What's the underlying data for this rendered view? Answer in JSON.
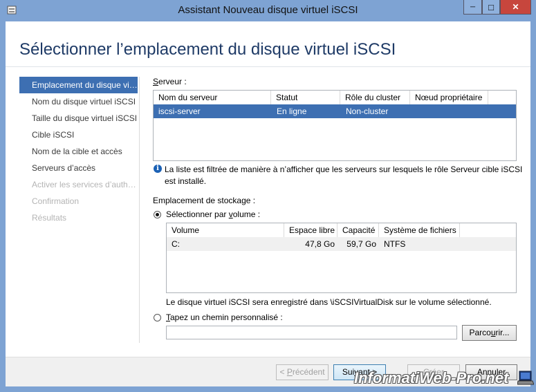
{
  "window": {
    "title": "Assistant Nouveau disque virtuel iSCSI",
    "page_title": "Sélectionner l’emplacement du disque virtuel iSCSI",
    "caption_minimize": "─",
    "caption_maximize": "□",
    "caption_close": "✕"
  },
  "sidebar": {
    "items": [
      {
        "label": "Emplacement du disque virtuel iSCSI",
        "state": "active"
      },
      {
        "label": "Nom du disque virtuel iSCSI",
        "state": "normal"
      },
      {
        "label": "Taille du disque virtuel iSCSI",
        "state": "normal"
      },
      {
        "label": "Cible iSCSI",
        "state": "normal"
      },
      {
        "label": "Nom de la cible et accès",
        "state": "normal"
      },
      {
        "label": "Serveurs d’accès",
        "state": "normal"
      },
      {
        "label": "Activer les services d’authentification",
        "state": "disabled"
      },
      {
        "label": "Confirmation",
        "state": "disabled"
      },
      {
        "label": "Résultats",
        "state": "disabled"
      }
    ]
  },
  "server_section": {
    "label_accel": "S",
    "label_rest": "erveur :",
    "columns": [
      "Nom du serveur",
      "Statut",
      "Rôle du cluster",
      "Nœud propriétaire"
    ],
    "rows": [
      {
        "name": "iscsi-server",
        "status": "En ligne",
        "role": "Non-cluster",
        "owner": ""
      }
    ],
    "info_glyph": "i",
    "info_text_line1": "La liste est filtrée de manière à n’afficher que les serveurs sur lesquels le rôle Serveur cible iSCSI",
    "info_text_line2": "est installé."
  },
  "storage_section": {
    "label": "Emplacement de stockage :",
    "by_volume_pre": "Sélectionner par ",
    "by_volume_accel": "v",
    "by_volume_post": "olume :",
    "volume_columns": [
      "Volume",
      "Espace libre",
      "Capacité",
      "Système de fichiers"
    ],
    "volumes": [
      {
        "volume": "C:",
        "free": "47,8 Go",
        "capacity": "59,7 Go",
        "fs": "NTFS"
      }
    ],
    "save_note": "Le disque virtuel iSCSI sera enregistré dans \\iSCSIVirtualDisk sur le volume sélectionné.",
    "custom_path_accel": "T",
    "custom_path_rest": "apez un chemin personnalisé :",
    "custom_path_value": "",
    "browse_pre": "Parco",
    "browse_accel": "u",
    "browse_post": "rir..."
  },
  "footer": {
    "previous_pre": "< ",
    "previous_accel": "P",
    "previous_post": "récédent",
    "next_pre": "Sui",
    "next_accel": "v",
    "next_post": "ant >",
    "create_pre": "",
    "create_accel": "C",
    "create_post": "réer",
    "cancel": "Annuler"
  },
  "watermark": "InformatiWeb-Pro.net",
  "colors": {
    "frame": "#7ea3d3",
    "selection": "#3d6fb2",
    "title_blue": "#1e3a66",
    "close_button": "#c7463d"
  }
}
